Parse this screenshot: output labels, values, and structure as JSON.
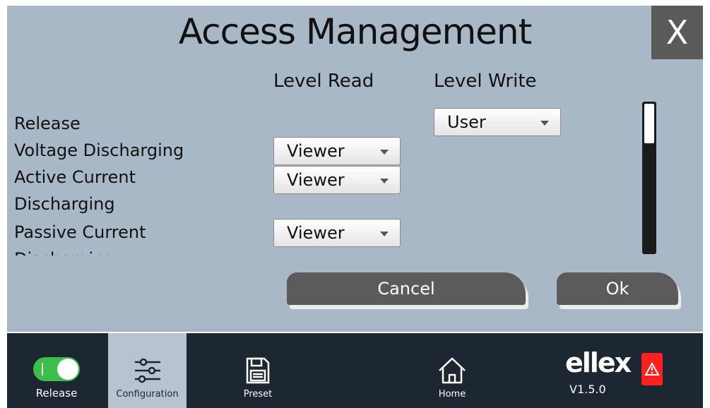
{
  "dialog": {
    "title": "Access Management",
    "close_label": "X",
    "columns": {
      "read": "Level Read",
      "write": "Level Write"
    },
    "rows": [
      {
        "label_lines": [
          "Release"
        ],
        "read": null,
        "write": "User"
      },
      {
        "label_lines": [
          "Voltage Discharging"
        ],
        "read": "Viewer",
        "write": null
      },
      {
        "label_lines": [
          "Active Current",
          "Discharging"
        ],
        "read": "Viewer",
        "write": null
      },
      {
        "label_lines": [
          "Passive Current",
          "Discharging"
        ],
        "read": "Viewer",
        "write": null
      }
    ],
    "scrollbar_position": 0.0,
    "cancel_label": "Cancel",
    "ok_label": "Ok"
  },
  "bottom_bar": {
    "items": [
      {
        "label": "Release",
        "icon": "toggle-switch-icon",
        "state": "on"
      },
      {
        "label": "Configuration",
        "icon": "sliders-icon",
        "active": true
      },
      {
        "label": "Preset",
        "icon": "floppy-disk-icon"
      },
      {
        "label": "Home",
        "icon": "house-icon"
      }
    ],
    "brand": "ellex",
    "version": "V1.5.0",
    "alarm_icon": "warning-triangle-icon"
  },
  "colors": {
    "dialog_bg": "#a9b8c6",
    "bar_bg": "#1d2731",
    "button_bg": "#5b5b5b",
    "toggle_on": "#3cbf4a",
    "alarm": "#ff2020"
  }
}
